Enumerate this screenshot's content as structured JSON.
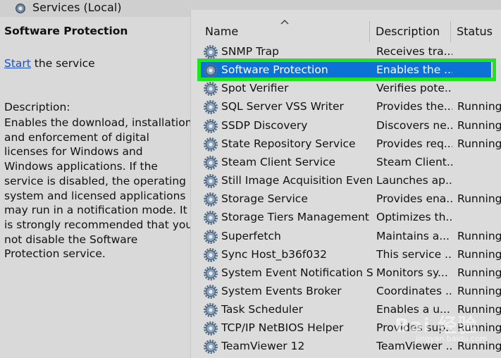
{
  "header": {
    "title": "Services (Local)",
    "icon": "services-gear-icon"
  },
  "left_pane": {
    "service_title": "Software Protection",
    "start_link": "Start",
    "start_suffix": " the service",
    "description_heading": "Description:",
    "description_text": "Enables the download, installation and enforcement of digital licenses for Windows and Windows applications. If the service is disabled, the operating system and licensed applications may run in a notification mode. It is strongly recommended that you not disable the Software Protection service."
  },
  "list": {
    "columns": {
      "name": "Name",
      "description": "Description",
      "status": "Status"
    },
    "rows": [
      {
        "name": "SNMP Trap",
        "description": "Receives tra...",
        "status": ""
      },
      {
        "name": "Software Protection",
        "description": "Enables the ...",
        "status": "",
        "selected": true
      },
      {
        "name": "Spot Verifier",
        "description": "Verifies pote...",
        "status": ""
      },
      {
        "name": "SQL Server VSS Writer",
        "description": "Provides the...",
        "status": "Running"
      },
      {
        "name": "SSDP Discovery",
        "description": "Discovers ne...",
        "status": "Running"
      },
      {
        "name": "State Repository Service",
        "description": "Provides req...",
        "status": "Running"
      },
      {
        "name": "Steam Client Service",
        "description": "Steam Client...",
        "status": ""
      },
      {
        "name": "Still Image Acquisition Events",
        "description": "Launches ap...",
        "status": ""
      },
      {
        "name": "Storage Service",
        "description": "Provides ena...",
        "status": "Running"
      },
      {
        "name": "Storage Tiers Management",
        "description": "Optimizes th...",
        "status": ""
      },
      {
        "name": "Superfetch",
        "description": "Maintains a...",
        "status": "Running"
      },
      {
        "name": "Sync Host_b36f032",
        "description": "This service ...",
        "status": "Running"
      },
      {
        "name": "System Event Notification S...",
        "description": "Monitors sy...",
        "status": "Running"
      },
      {
        "name": "System Events Broker",
        "description": "Coordinates ...",
        "status": "Running"
      },
      {
        "name": "Task Scheduler",
        "description": "Enables a u...",
        "status": "Running"
      },
      {
        "name": "TCP/IP NetBIOS Helper",
        "description": "Provides sup...",
        "status": "Running"
      },
      {
        "name": "TeamViewer 12",
        "description": "TeamViewer ...",
        "status": "Running"
      }
    ]
  },
  "watermark": {
    "main": "Bai 经验",
    "sub": "jingyan.baidu.com"
  },
  "colors": {
    "selection": "#0c72d6",
    "highlight_box": "#1fe51f",
    "link": "#1a4fc8"
  }
}
